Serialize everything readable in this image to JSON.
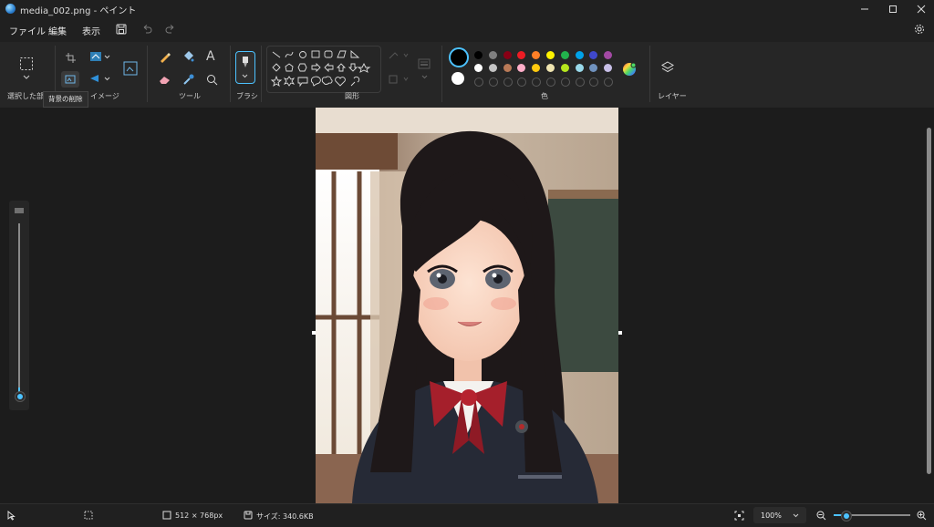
{
  "window": {
    "title": "media_002.png - ペイント"
  },
  "menu": {
    "file": "ファイル",
    "edit": "編集",
    "view": "表示"
  },
  "ribbon": {
    "selection_label": "選択した部分",
    "image_label": "イメージ",
    "tools_label": "ツール",
    "brush_label": "ブラシ",
    "shapes_label": "図形",
    "colors_label": "色",
    "layers_label": "レイヤー",
    "tooltip": "背景の削除"
  },
  "palette": {
    "row1": [
      "#000000",
      "#7f7f7f",
      "#880015",
      "#ed1c24",
      "#ff7f27",
      "#fff200",
      "#22b14c",
      "#00a2e8",
      "#3f48cc",
      "#a349a4"
    ],
    "row2": [
      "#ffffff",
      "#c3c3c3",
      "#b97a57",
      "#ffaec9",
      "#ffc90e",
      "#efe4b0",
      "#b5e61d",
      "#99d9ea",
      "#7092be",
      "#c8bfe7"
    ],
    "primary": "#000000",
    "secondary": "#ffffff",
    "accent": "#4cc2ff"
  },
  "status": {
    "dimensions": "512 × 768px",
    "size": "サイズ: 340.6KB",
    "zoom": "100%"
  }
}
